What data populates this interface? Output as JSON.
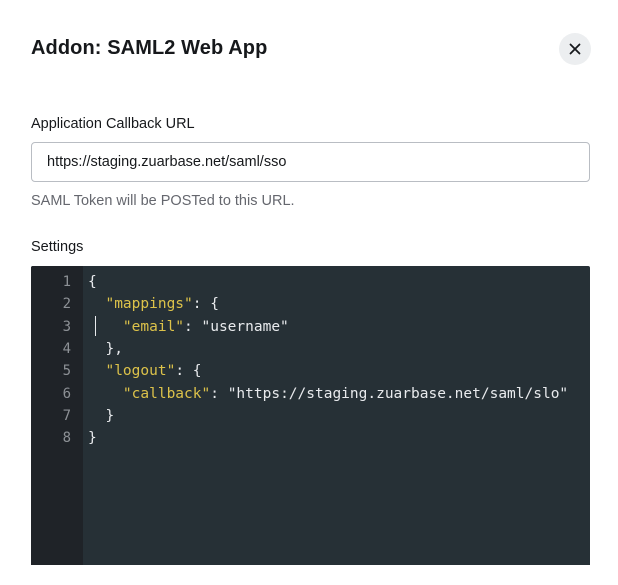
{
  "dialog": {
    "title": "Addon: SAML2 Web App",
    "close_icon": "close-icon"
  },
  "callback": {
    "label": "Application Callback URL",
    "value": "https://staging.zuarbase.net/saml/sso",
    "help": "SAML Token will be POSTed to this URL."
  },
  "settings": {
    "label": "Settings",
    "line_numbers": [
      "1",
      "2",
      "3",
      "4",
      "5",
      "6",
      "7",
      "8"
    ],
    "lines": [
      {
        "pre": "{",
        "key": "",
        "post": ""
      },
      {
        "pre": "  ",
        "key": "\"mappings\"",
        "post": ": {"
      },
      {
        "pre": "    ",
        "key": "\"email\"",
        "post": ": \"username\""
      },
      {
        "pre": "  },",
        "key": "",
        "post": ""
      },
      {
        "pre": "  ",
        "key": "\"logout\"",
        "post": ": {"
      },
      {
        "pre": "    ",
        "key": "\"callback\"",
        "post": ": \"https://staging.zuarbase.net/saml/slo\""
      },
      {
        "pre": "  }",
        "key": "",
        "post": ""
      },
      {
        "pre": "}",
        "key": "",
        "post": ""
      }
    ]
  },
  "colors": {
    "editor_bg": "#263036",
    "gutter_bg": "#1f2328",
    "json_key": "#dcc24a",
    "code_text": "#e8eaed"
  }
}
